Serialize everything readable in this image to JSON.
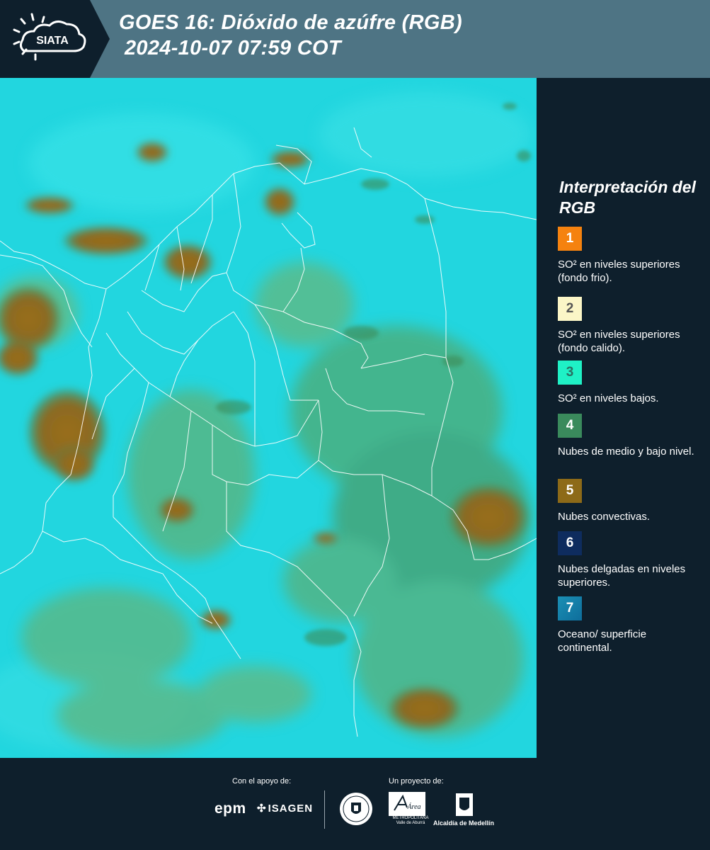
{
  "header": {
    "logo_text": "SIATA",
    "title_line1": "GOES 16: Dióxido de azúfre (RGB)",
    "title_line2": "2024-10-07 07:59 COT",
    "background_color": "#4e7484",
    "logo_panel_color": "#0e1f2c"
  },
  "map": {
    "description_icon": "satellite-map",
    "base_color": "#20d8e0",
    "border_color": "#ffffff"
  },
  "legend": {
    "title": "Interpretación del RGB",
    "items": [
      {
        "number": "1",
        "label": "SO² en niveles superiores (fondo frio).",
        "color": "#f5820f",
        "number_color": "#ffffff"
      },
      {
        "number": "2",
        "label": "SO² en niveles superiores (fondo calido).",
        "color": "#fbf6c7",
        "number_color": "#555555"
      },
      {
        "number": "3",
        "label": "SO² en niveles bajos.",
        "color": "#1ff1c6",
        "number_color": "#2a6f62"
      },
      {
        "number": "4",
        "label": "Nubes de medio y bajo nivel.",
        "color": "#3a8a5c",
        "number_color": "#ffffff"
      },
      {
        "number": "5",
        "label": "Nubes convectivas.",
        "color": "#8d6a18",
        "number_color": "#ffffff"
      },
      {
        "number": "6",
        "label": "Nubes delgadas en niveles superiores.",
        "color": "#0e2c5e",
        "number_color": "#ffffff"
      },
      {
        "number": "7",
        "label": "Oceano/ superficie continental.",
        "color": "#1b8fb4",
        "number_color": "#ffffff"
      }
    ]
  },
  "footer": {
    "support_label": "Con el apoyo de:",
    "project_label": "Un proyecto de:",
    "epm": "epm",
    "isagen": "ISAGEN",
    "area_name": "Área",
    "area_sub": "METROPOLITANA Valle de Aburrá",
    "alcaldia": "Alcaldía de Medellín"
  }
}
